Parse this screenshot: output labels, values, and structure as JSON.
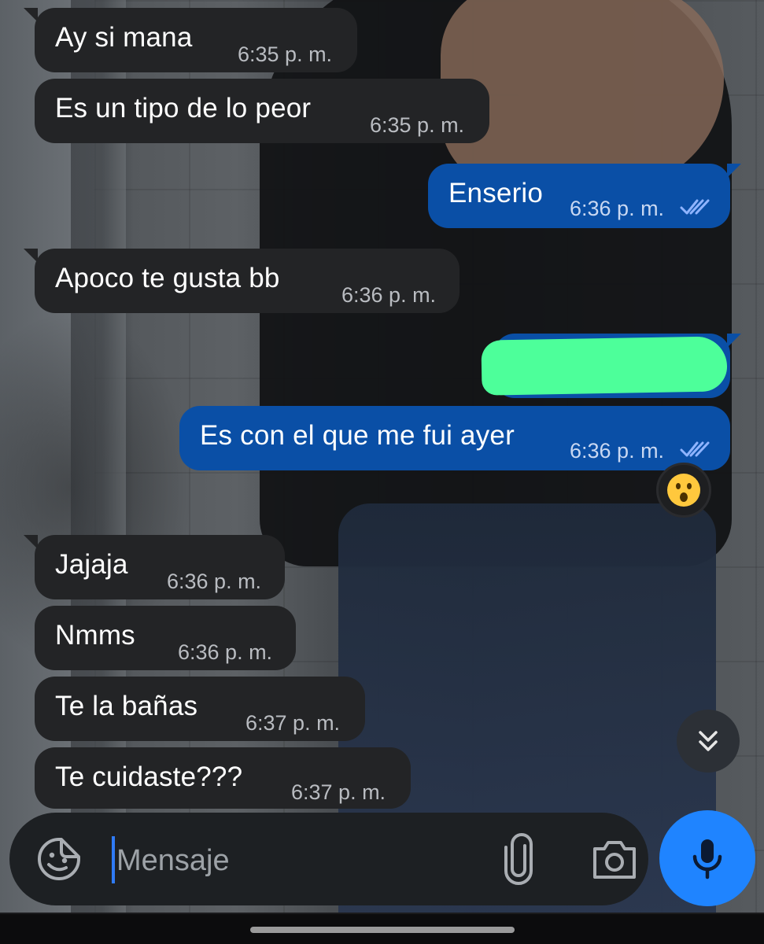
{
  "conversation": {
    "messages": [
      {
        "direction": "incoming",
        "text": "Ay si mana",
        "time": "6:35 p. m."
      },
      {
        "direction": "incoming",
        "text": "Es un tipo de lo peor",
        "time": "6:35 p. m."
      },
      {
        "direction": "outgoing",
        "text": "Enserio",
        "time": "6:36 p. m.",
        "status": "read"
      },
      {
        "direction": "incoming",
        "text": "Apoco te gusta bb",
        "time": "6:36 p. m."
      },
      {
        "direction": "outgoing",
        "text": "",
        "time": "",
        "status": "read",
        "redacted": true
      },
      {
        "direction": "outgoing",
        "text": "Es con el que me fui ayer",
        "time": "6:36 p. m.",
        "status": "read",
        "reaction": "😮"
      },
      {
        "direction": "incoming",
        "text": "Jajaja",
        "time": "6:36 p. m."
      },
      {
        "direction": "incoming",
        "text": "Nmms",
        "time": "6:36 p. m."
      },
      {
        "direction": "incoming",
        "text": "Te la bañas",
        "time": "6:37 p. m."
      },
      {
        "direction": "incoming",
        "text": "Te cuidaste???",
        "time": "6:37 p. m."
      }
    ]
  },
  "composer": {
    "placeholder": "Mensaje",
    "value": ""
  },
  "icons": {
    "emoji": "sticker-emoji-icon",
    "attach": "paperclip-icon",
    "camera": "camera-icon",
    "mic": "microphone-icon",
    "scroll": "double-chevron-down-icon",
    "read_status": "double-check-icon"
  },
  "colors": {
    "incoming_bubble": "#232426",
    "outgoing_bubble": "#0a4fa6",
    "accent": "#1f84ff",
    "redaction_mark": "#4dff9a"
  }
}
